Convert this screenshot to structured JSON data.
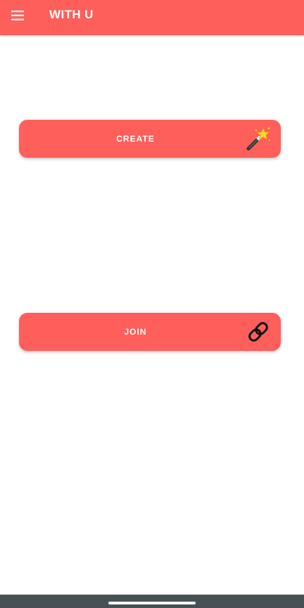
{
  "app_bar": {
    "title": "WITH U",
    "menu_icon": "hamburger-menu-icon"
  },
  "buttons": {
    "create": {
      "label": "CREATE",
      "icon": "magic-wand-icon"
    },
    "join": {
      "label": "JOIN",
      "icon": "link-icon"
    }
  },
  "colors": {
    "accent": "#ff5f5a",
    "nav_bar": "#455152",
    "text_on_accent": "#ffffff"
  }
}
